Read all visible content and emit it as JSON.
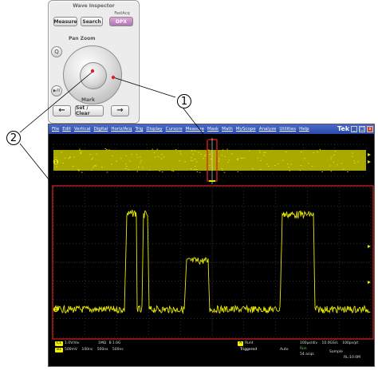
{
  "front_panel": {
    "title": "Wave Inspector",
    "fastacq_label": "FastAcq",
    "buttons": {
      "measure": "Measure",
      "search": "Search",
      "dpx": "DPX"
    },
    "pan_zoom_label": "Pan Zoom",
    "side_buttons": {
      "magnify": "Q",
      "play_pause": "▶/II"
    },
    "mark_label": "Mark",
    "prev_arrow": "←",
    "set_clear": "Set / Clear",
    "next_arrow": "→"
  },
  "callouts": {
    "one": "1",
    "two": "2"
  },
  "menu": {
    "items": [
      "File",
      "Edit",
      "Vertical",
      "Digital",
      "Horiz/Acq",
      "Trig",
      "Display",
      "Cursors",
      "Measure",
      "Mask",
      "Math",
      "MyScope",
      "Analyze",
      "Utilities",
      "Help"
    ],
    "brand": "Tek",
    "window_buttons": {
      "minimize": "_",
      "maximize": "□",
      "close": "x"
    }
  },
  "status": {
    "ch1": {
      "badge": "C1",
      "scale": "1.0V/div",
      "impedance": "1MΩ",
      "bandwidth": "B",
      "bw_value": "1.0G",
      "offset": "500mV",
      "time1": "100ns",
      "time2": "500ns",
      "time3": "500ns"
    },
    "ch_b": {
      "badge": "B1"
    },
    "trigger": {
      "badge": "A",
      "mode": "Runt",
      "state": "Triggered",
      "mode2": "Auto"
    },
    "horizontal": {
      "scale": "100µs/div",
      "rate": "10.0GS/s",
      "resolution": "100ps/pt",
      "run": "Run",
      "acq": "Sample",
      "acqs": "54 acqs",
      "record": "RL:10.0M"
    }
  },
  "colors": {
    "waveform": "#e8e800",
    "grid": "#5a5a5a",
    "highlight": "#e02020",
    "menubar": "#2c4aa8"
  },
  "markers": {
    "ch1": "1"
  }
}
